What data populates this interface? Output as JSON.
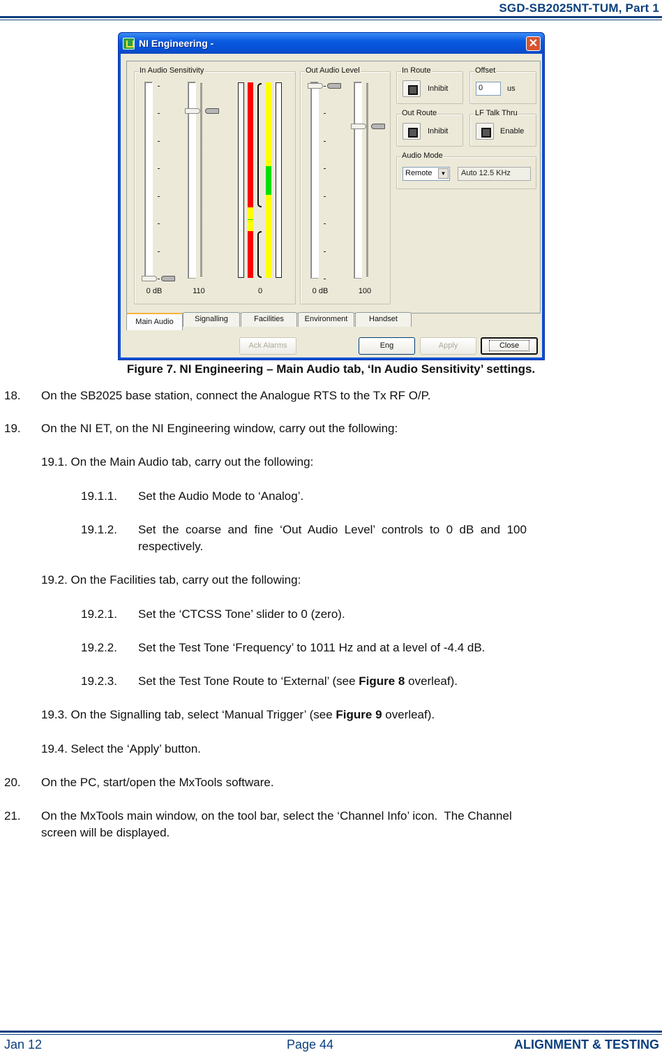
{
  "header": {
    "doc_title": "SGD-SB2025NT-TUM, Part 1"
  },
  "footer": {
    "date": "Jan 12",
    "page": "Page 44",
    "section": "ALIGNMENT & TESTING"
  },
  "window": {
    "title": "NI Engineering -",
    "close_icon": "close-x-icon",
    "in_audio_sensitivity": {
      "label": "In Audio Sensitivity",
      "coarse_value": "0 dB",
      "fine_value": "110",
      "meter_value": "0"
    },
    "out_audio_level": {
      "label": "Out Audio Level",
      "coarse_value": "0 dB",
      "fine_value": "100"
    },
    "in_route": {
      "label": "In Route",
      "button_text": "Inhibit"
    },
    "offset": {
      "label": "Offset",
      "value": "0",
      "unit": "us"
    },
    "out_route": {
      "label": "Out Route",
      "button_text": "Inhibit"
    },
    "lf_talk_thru": {
      "label": "LF Talk Thru",
      "button_text": "Enable"
    },
    "audio_mode": {
      "label": "Audio Mode",
      "selected": "Remote",
      "readout": "Auto 12.5 KHz"
    },
    "tabs": [
      {
        "label": "Main Audio",
        "active": true
      },
      {
        "label": "Signalling",
        "active": false
      },
      {
        "label": "Facilities",
        "active": false
      },
      {
        "label": "Environment",
        "active": false
      },
      {
        "label": "Handset",
        "active": false
      }
    ],
    "buttons": {
      "ack_alarms": "Ack Alarms",
      "eng": "Eng",
      "apply": "Apply",
      "close": "Close"
    }
  },
  "figure_caption": "Figure 7.  NI Engineering – Main Audio tab, ‘In Audio Sensitivity’ settings.",
  "steps": {
    "s18": {
      "num": "18.",
      "text": "On the SB2025 base station, connect the Analogue RTS to the Tx RF O/P."
    },
    "s19": {
      "num": "19.",
      "text": "On the NI ET, on the NI Engineering window, carry out the following:"
    },
    "s19_1": {
      "text": "19.1. On the Main Audio tab, carry out the following:"
    },
    "s19_1_1": {
      "num": "19.1.1.",
      "text": "Set the Audio Mode to ‘Analog’."
    },
    "s19_1_2": {
      "num": "19.1.2.",
      "text_line1": "Set  the  coarse  and  fine  ‘Out  Audio  Level’  controls  to  0  dB  and  100",
      "text_line2": "respectively."
    },
    "s19_2": {
      "text": "19.2. On the Facilities tab, carry out the following:"
    },
    "s19_2_1": {
      "num": "19.2.1.",
      "text": "Set the ‘CTCSS Tone’ slider to 0 (zero)."
    },
    "s19_2_2": {
      "num": "19.2.2.",
      "text": "Set the Test Tone ‘Frequency’ to 1011 Hz and at a level of -4.4 dB."
    },
    "s19_2_3": {
      "num": "19.2.3.",
      "text_pre": "Set the Test Tone Route to ‘External’ (see ",
      "text_bold": "Figure 8",
      "text_post": " overleaf)."
    },
    "s19_3": {
      "text_pre": "19.3. On the Signalling tab, select ‘Manual Trigger’ (see ",
      "text_bold": "Figure 9",
      "text_post": " overleaf)."
    },
    "s19_4": {
      "text": "19.4. Select the ‘Apply’ button."
    },
    "s20": {
      "num": "20.",
      "text": "On the PC, start/open the MxTools software."
    },
    "s21": {
      "num": "21.",
      "text_line1": "On the MxTools main window, on the tool bar, select the ‘Channel Info’ icon.  The Channel",
      "text_line2": "screen will be displayed."
    }
  }
}
